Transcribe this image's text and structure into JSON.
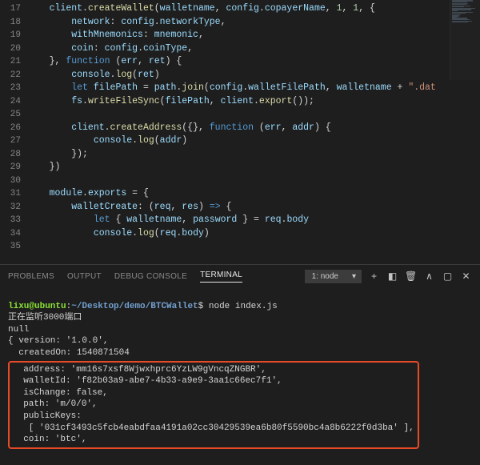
{
  "editor": {
    "first_line": 17,
    "lines": [
      {
        "tokens": [
          [
            "obj",
            "client"
          ],
          [
            "punc",
            "."
          ],
          [
            "method",
            "createWallet"
          ],
          [
            "punc",
            "("
          ],
          [
            "param",
            "walletname"
          ],
          [
            "punc",
            ", "
          ],
          [
            "obj",
            "config"
          ],
          [
            "punc",
            "."
          ],
          [
            "prop",
            "copayerName"
          ],
          [
            "punc",
            ", "
          ],
          [
            "num",
            "1"
          ],
          [
            "punc",
            ", "
          ],
          [
            "num",
            "1"
          ],
          [
            "punc",
            ", {"
          ]
        ]
      },
      {
        "indent": 2,
        "tokens": [
          [
            "prop",
            "network"
          ],
          [
            "punc",
            ": "
          ],
          [
            "obj",
            "config"
          ],
          [
            "punc",
            "."
          ],
          [
            "prop",
            "networkType"
          ],
          [
            "punc",
            ","
          ]
        ]
      },
      {
        "indent": 2,
        "tokens": [
          [
            "prop",
            "withMnemonics"
          ],
          [
            "punc",
            ": "
          ],
          [
            "obj",
            "mnemonic"
          ],
          [
            "punc",
            ","
          ]
        ]
      },
      {
        "indent": 2,
        "tokens": [
          [
            "prop",
            "coin"
          ],
          [
            "punc",
            ": "
          ],
          [
            "obj",
            "config"
          ],
          [
            "punc",
            "."
          ],
          [
            "prop",
            "coinType"
          ],
          [
            "punc",
            ","
          ]
        ]
      },
      {
        "tokens": [
          [
            "punc",
            "}, "
          ],
          [
            "kw",
            "function"
          ],
          [
            "punc",
            " ("
          ],
          [
            "param",
            "err"
          ],
          [
            "punc",
            ", "
          ],
          [
            "param",
            "ret"
          ],
          [
            "punc",
            ") {"
          ]
        ]
      },
      {
        "indent": 2,
        "tokens": [
          [
            "obj",
            "console"
          ],
          [
            "punc",
            "."
          ],
          [
            "method",
            "log"
          ],
          [
            "punc",
            "("
          ],
          [
            "param",
            "ret"
          ],
          [
            "punc",
            ")"
          ]
        ]
      },
      {
        "indent": 2,
        "tokens": [
          [
            "kw",
            "let"
          ],
          [
            "punc",
            " "
          ],
          [
            "obj",
            "filePath"
          ],
          [
            "punc",
            " = "
          ],
          [
            "obj",
            "path"
          ],
          [
            "punc",
            "."
          ],
          [
            "method",
            "join"
          ],
          [
            "punc",
            "("
          ],
          [
            "obj",
            "config"
          ],
          [
            "punc",
            "."
          ],
          [
            "prop",
            "walletFilePath"
          ],
          [
            "punc",
            ", "
          ],
          [
            "param",
            "walletname"
          ],
          [
            "punc",
            " + "
          ],
          [
            "str",
            "\".dat"
          ]
        ]
      },
      {
        "indent": 2,
        "tokens": [
          [
            "obj",
            "fs"
          ],
          [
            "punc",
            "."
          ],
          [
            "method",
            "writeFileSync"
          ],
          [
            "punc",
            "("
          ],
          [
            "obj",
            "filePath"
          ],
          [
            "punc",
            ", "
          ],
          [
            "obj",
            "client"
          ],
          [
            "punc",
            "."
          ],
          [
            "method",
            "export"
          ],
          [
            "punc",
            "());"
          ]
        ]
      },
      {
        "tokens": [
          [
            "punc",
            ""
          ]
        ]
      },
      {
        "indent": 2,
        "tokens": [
          [
            "obj",
            "client"
          ],
          [
            "punc",
            "."
          ],
          [
            "method",
            "createAddress"
          ],
          [
            "punc",
            "({}, "
          ],
          [
            "kw",
            "function"
          ],
          [
            "punc",
            " ("
          ],
          [
            "param",
            "err"
          ],
          [
            "punc",
            ", "
          ],
          [
            "param",
            "addr"
          ],
          [
            "punc",
            ") {"
          ]
        ]
      },
      {
        "indent": 4,
        "tokens": [
          [
            "obj",
            "console"
          ],
          [
            "punc",
            "."
          ],
          [
            "method",
            "log"
          ],
          [
            "punc",
            "("
          ],
          [
            "param",
            "addr"
          ],
          [
            "punc",
            ")"
          ]
        ]
      },
      {
        "indent": 2,
        "tokens": [
          [
            "punc",
            "});"
          ]
        ]
      },
      {
        "tokens": [
          [
            "punc",
            "})"
          ]
        ]
      },
      {
        "tokens": [
          [
            "punc",
            ""
          ]
        ]
      },
      {
        "tokens": [
          [
            "obj",
            "module"
          ],
          [
            "punc",
            "."
          ],
          [
            "prop",
            "exports"
          ],
          [
            "punc",
            " = {"
          ]
        ]
      },
      {
        "indent": 2,
        "tokens": [
          [
            "prop",
            "walletCreate"
          ],
          [
            "punc",
            ": ("
          ],
          [
            "param",
            "req"
          ],
          [
            "punc",
            ", "
          ],
          [
            "param",
            "res"
          ],
          [
            "punc",
            ") "
          ],
          [
            "kw",
            "=>"
          ],
          [
            "punc",
            " {"
          ]
        ]
      },
      {
        "indent": 4,
        "tokens": [
          [
            "kw",
            "let"
          ],
          [
            "punc",
            " { "
          ],
          [
            "param",
            "walletname"
          ],
          [
            "punc",
            ", "
          ],
          [
            "param",
            "password"
          ],
          [
            "punc",
            " } = "
          ],
          [
            "obj",
            "req"
          ],
          [
            "punc",
            "."
          ],
          [
            "prop",
            "body"
          ]
        ]
      },
      {
        "indent": 4,
        "tokens": [
          [
            "obj",
            "console"
          ],
          [
            "punc",
            "."
          ],
          [
            "method",
            "log"
          ],
          [
            "punc",
            "("
          ],
          [
            "obj",
            "req"
          ],
          [
            "punc",
            "."
          ],
          [
            "prop",
            "body"
          ],
          [
            "punc",
            ")"
          ]
        ]
      },
      {
        "tokens": [
          [
            "punc",
            ""
          ]
        ]
      }
    ]
  },
  "panel": {
    "tabs": {
      "problems": "PROBLEMS",
      "output": "OUTPUT",
      "debug": "DEBUG CONSOLE",
      "terminal": "TERMINAL"
    },
    "task_label": "1: node",
    "terminal": {
      "user": "lixu@ubuntu",
      "path": "~/Desktop/demo/BTCWallet",
      "command": "node index.js",
      "listen": "正在监听3000端口",
      "null": "null",
      "obj_open": "{ version: '1.0.0',",
      "createdOn": "  createdOn: 1540871504",
      "addr_line": "  address: 'mm16s7xsf8Wjwxhprc6YzLW9gVncqZNGBR',",
      "wallet_line": "  walletId: 'f82b03a9-abe7-4b33-a9e9-3aa1c66ec7f1',",
      "change_line": "  isChange: false,",
      "path_line": "  path: 'm/0/0',",
      "pubkeys_line": "  publicKeys:",
      "pubkeys_arr": "   [ '031cf3493c5fcb4eabdfaa4191a02cc30429539ea6b80f5590bc4a8b6222f0d3ba' ],",
      "coin_line": "  coin: 'btc',"
    }
  }
}
